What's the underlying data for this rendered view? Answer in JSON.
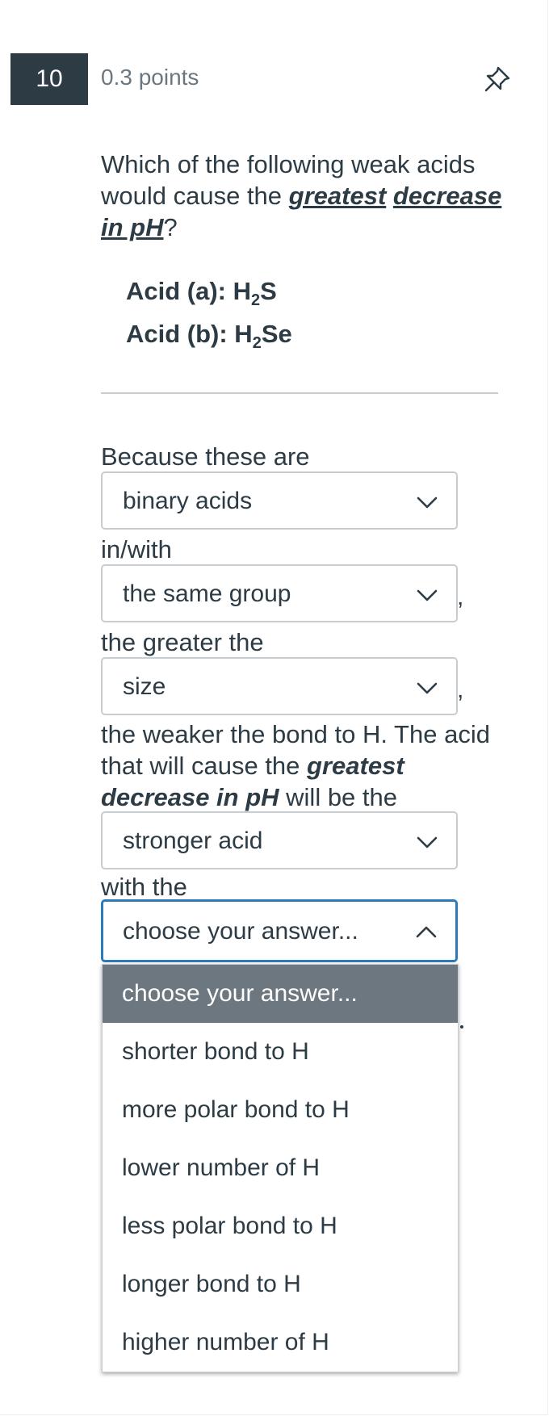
{
  "question": {
    "number": "10",
    "points": "0.3 points",
    "text_pre": "Which of the following weak acids would cause the ",
    "text_bold1": "greatest",
    "text_space": " ",
    "text_bold2": "decrease in pH",
    "text_post": "?",
    "acid_a_label": "Acid (a):  H",
    "acid_a_sub": "2",
    "acid_a_tail": "S",
    "acid_b_label": "Acid (b):  H",
    "acid_b_sub": "2",
    "acid_b_tail": "Se"
  },
  "answer": {
    "line1": "Because these are",
    "select1": "binary acids",
    "line2": "in/with",
    "select2": "the same group",
    "line3": "the greater the",
    "select3": "size",
    "line4_a": "the weaker the bond to H. The acid that will cause the ",
    "line4_bold": "greatest decrease in pH",
    "line4_b": " will be the",
    "select4": "stronger acid",
    "line5": "with the",
    "select5": "choose your answer...",
    "comma": ","
  },
  "dropdown_options": [
    "choose your answer...",
    "shorter bond to H",
    "more polar bond to H",
    "lower number of H",
    "less polar bond to H",
    "longer bond to H",
    "higher number of H"
  ],
  "icons": {
    "pin": "pin-icon",
    "chevron_down": "chevron-down-icon",
    "chevron_up": "chevron-up-icon"
  },
  "colors": {
    "badge_bg": "#2d3b45",
    "focus_border": "#2b7abc",
    "selected_option_bg": "#6c7780"
  }
}
